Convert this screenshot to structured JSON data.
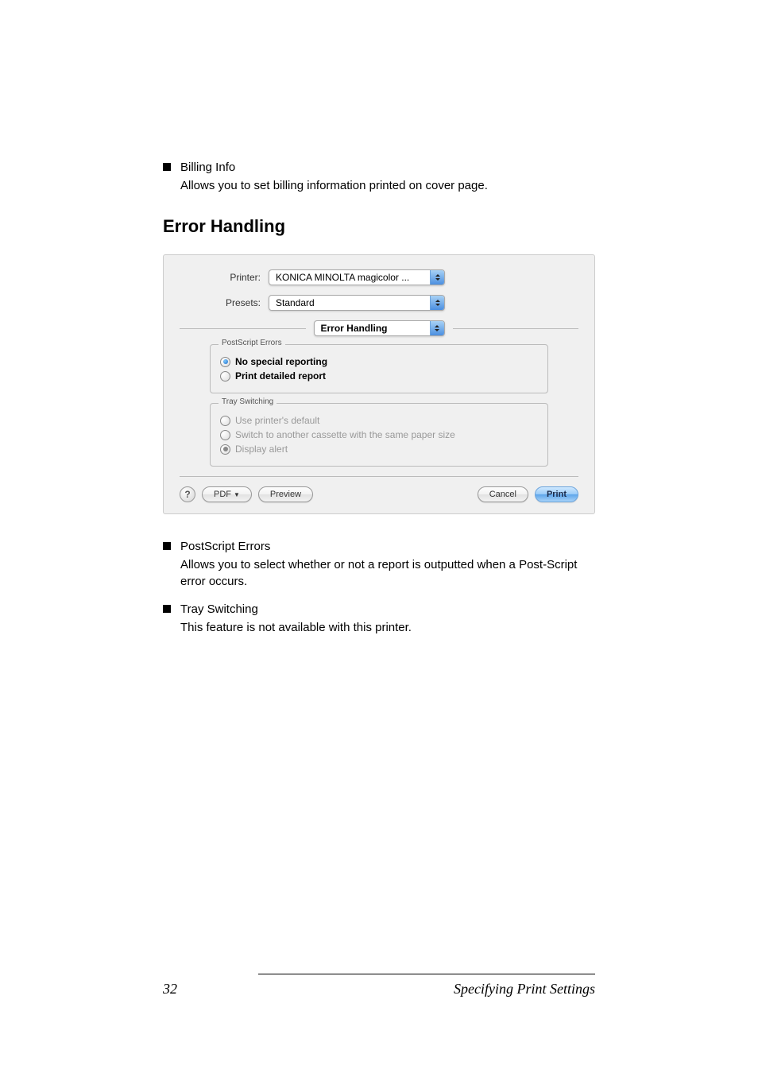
{
  "top_section": {
    "billing_title": "Billing Info",
    "billing_desc": "Allows you to set billing information printed on cover page."
  },
  "heading": "Error Handling",
  "dialog": {
    "printer_label": "Printer:",
    "printer_value": "KONICA MINOLTA magicolor ...",
    "presets_label": "Presets:",
    "presets_value": "Standard",
    "section_value": "Error Handling",
    "fieldset1_legend": "PostScript Errors",
    "fieldset1_opt1": "No special reporting",
    "fieldset1_opt2": "Print detailed report",
    "fieldset2_legend": "Tray Switching",
    "fieldset2_opt1": "Use printer's default",
    "fieldset2_opt2": "Switch to another cassette with the same paper size",
    "fieldset2_opt3": "Display alert",
    "help_label": "?",
    "pdf_label": "PDF",
    "preview_label": "Preview",
    "cancel_label": "Cancel",
    "print_label": "Print"
  },
  "bottom_section": {
    "postscript_title": "PostScript Errors",
    "postscript_desc": "Allows you to select whether or not a report is outputted when a Post-Script error occurs.",
    "tray_title": "Tray Switching",
    "tray_desc": "This feature is not available with this printer."
  },
  "footer": {
    "page_num": "32",
    "title": "Specifying Print Settings"
  }
}
